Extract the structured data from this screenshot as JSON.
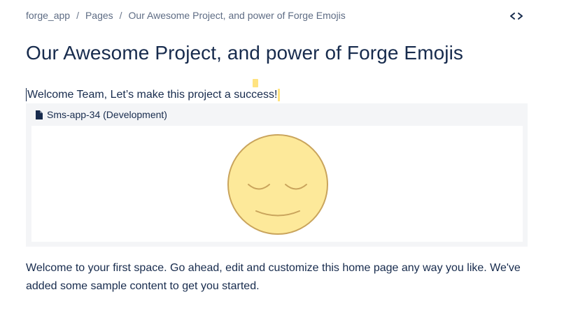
{
  "breadcrumb": {
    "items": [
      "forge_app",
      "Pages",
      "Our Awesome Project, and power of Forge Emojis"
    ],
    "separator": "/"
  },
  "header": {
    "expand_icon": "expand-width-icon"
  },
  "page": {
    "title": "Our Awesome Project, and power of Forge Emojis",
    "welcome_line": "Welcome Team, Let’s make this project a success!"
  },
  "macro": {
    "doc_icon": "document-icon",
    "title": "Sms-app-34 (Development)",
    "emoji": "relieved-face"
  },
  "content": {
    "intro": "Welcome to your first space. Go ahead, edit and customize this home page any way you like. We've added some sample content to get you started."
  },
  "colors": {
    "text": "#172b4d",
    "muted": "#5e6c84",
    "macro_bg": "#f4f5f7",
    "emoji_fill": "#fde99a",
    "emoji_stroke": "#c9a45c",
    "highlight": "#ffe380"
  }
}
